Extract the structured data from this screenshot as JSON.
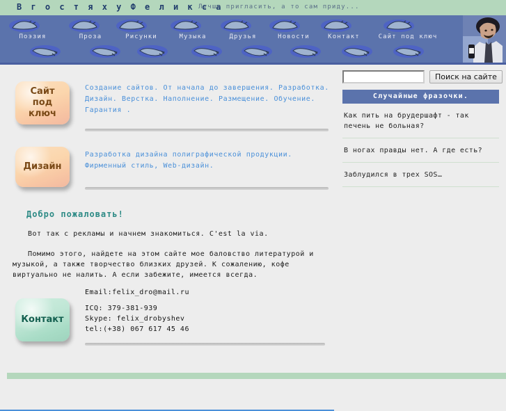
{
  "header": {
    "title": "В  г о с т я х  у  Ф е л и к с а",
    "tagline": "Лучше пригласить, а то сам приду..."
  },
  "nav": {
    "items": [
      {
        "label": "Поэзия",
        "icon": "footprint-icon"
      },
      {
        "label": "Проза",
        "icon": "footprint-icon"
      },
      {
        "label": "Рисунки",
        "icon": "footprint-icon"
      },
      {
        "label": "Музыка",
        "icon": "footprint-icon"
      },
      {
        "label": "Друзья",
        "icon": "footprint-icon"
      },
      {
        "label": "Новости",
        "icon": "footprint-icon"
      },
      {
        "label": "Контакт",
        "icon": "footprint-icon"
      },
      {
        "label": "Сайт под ключ",
        "icon": "footprint-icon"
      }
    ],
    "photo_alt": "portrait-photo"
  },
  "search": {
    "value": "",
    "placeholder": "",
    "button_label": "Поиск на сайте"
  },
  "sidebar": {
    "header": "Случайные фразочки.",
    "phrases": [
      "Как пить на брудершафт - так печень не больная?",
      "В ногах правды нет. А где есть?",
      "Заблудился в трех SOS…"
    ]
  },
  "services": [
    {
      "badge": "Сайт под ключ",
      "badge_lines": [
        "Сайт",
        "под",
        "ключ"
      ],
      "text": "Создание сайтов. От начала до завершения. Разработка. Дизайн. Верстка. Наполнение. Размещение. Обучение. Гарантия ."
    },
    {
      "badge": "Дизайн",
      "badge_lines": [
        "Дизайн"
      ],
      "text": "Разработка дизайна полиграфической продукции. Фирменный стиль, Web-дизайн."
    }
  ],
  "welcome": {
    "title": "Добро пожаловать!",
    "paragraphs": [
      "Вот так с рекламы и начнем знакомиться. C'est la via.",
      "Помимо этого, найдете на этом сайте мое баловство литературой и музыкой, а также творчество близких друзей. К сожалению, кофе виртуально не налить. А если забежите, имеется всегда."
    ]
  },
  "contact": {
    "badge": "Контакт",
    "email": "Email:felix_dro@mail.ru",
    "icq": "ICQ: 379-381-939",
    "skype": "Skype: felix_drobyshev",
    "tel": "tel:(+38) 067 617 45 46"
  },
  "colors": {
    "header_green": "#b4d7bc",
    "nav_blue": "#5b73ac",
    "link_blue": "#4a90d9",
    "welcome_teal": "#2e8b86",
    "page_bg": "#ededed"
  }
}
